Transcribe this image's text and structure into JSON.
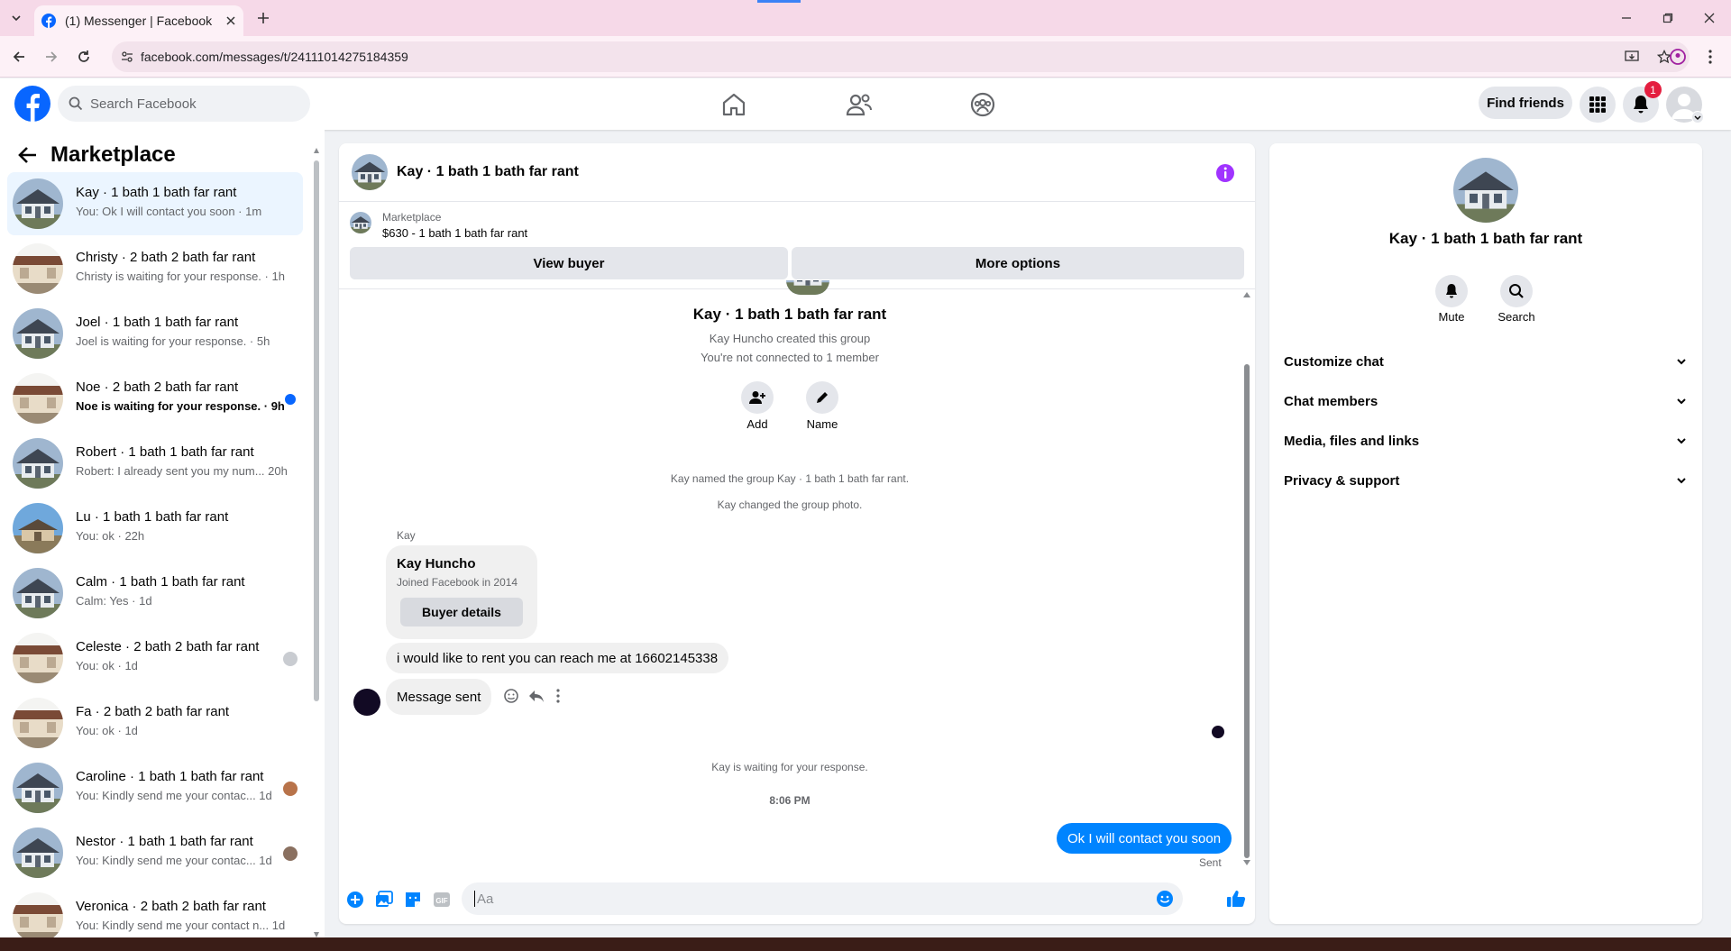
{
  "browser": {
    "tab_title": "(1) Messenger | Facebook",
    "url": "facebook.com/messages/t/24111014275184359"
  },
  "header": {
    "search_placeholder": "Search Facebook",
    "find_friends": "Find friends",
    "notification_count": "1"
  },
  "sidebar": {
    "title": "Marketplace",
    "conversations": [
      {
        "name": "Kay · 1 bath 1 bath far rant",
        "preview": "You: Ok I will contact you soon · 1m",
        "thumb": "house-gray",
        "active": true
      },
      {
        "name": "Christy · 2 bath 2 bath far rant",
        "preview": "Christy is waiting for your response. · 1h",
        "thumb": "house-brown"
      },
      {
        "name": "Joel · 1 bath 1 bath far rant",
        "preview": "Joel is waiting for your response. · 5h",
        "thumb": "house-gray"
      },
      {
        "name": "Noe · 2 bath 2 bath far rant",
        "preview": "Noe is waiting for your response. · 9h",
        "thumb": "house-brown",
        "unread": true
      },
      {
        "name": "Robert · 1 bath 1 bath far rant",
        "preview": "Robert: I already sent you my num...  20h",
        "thumb": "house-gray"
      },
      {
        "name": "Lu · 1 bath 1 bath far rant",
        "preview": "You: ok · 22h",
        "thumb": "house-sky"
      },
      {
        "name": "Calm · 1 bath 1 bath far rant",
        "preview": "Calm: Yes · 1d",
        "thumb": "house-gray"
      },
      {
        "name": "Celeste · 2 bath 2 bath far rant",
        "preview": "You: ok · 1d",
        "thumb": "house-brown",
        "tag": "avatar-gray"
      },
      {
        "name": "Fa · 2 bath 2 bath far rant",
        "preview": "You: ok · 1d",
        "thumb": "house-brown"
      },
      {
        "name": "Caroline · 1 bath 1 bath far rant",
        "preview": "You: Kindly send me your contac...  1d",
        "thumb": "house-gray",
        "tag": "avatar-orange"
      },
      {
        "name": "Nestor · 1 bath 1 bath far rant",
        "preview": "You: Kindly send me your contac...  1d",
        "thumb": "house-gray",
        "tag": "avatar-brown"
      },
      {
        "name": "Veronica · 2 bath 2 bath far rant",
        "preview": "You: Kindly send me your contact n...  1d",
        "thumb": "house-brown"
      }
    ]
  },
  "chat": {
    "title": "Kay · 1 bath 1 bath far rant",
    "marketplace_label": "Marketplace",
    "listing": "$630 - 1 bath 1 bath far rant",
    "view_buyer": "View buyer",
    "more_options": "More options",
    "intro_title": "Kay · 1 bath 1 bath far rant",
    "created_by": "Kay Huncho created this group",
    "not_connected": "You're not connected to 1 member",
    "add_label": "Add",
    "name_label": "Name",
    "event1": "Kay named the group Kay · 1 bath 1 bath far rant.",
    "event2": "Kay changed the group photo.",
    "sender": "Kay",
    "card_name": "Kay Huncho",
    "card_joined": "Joined Facebook in 2014",
    "buyer_details": "Buyer details",
    "msg1": "i would like to rent you can reach me at 16602145338",
    "msg2": "Message sent",
    "waiting": "Kay is waiting for your response.",
    "time": "8:06 PM",
    "my_msg": "Ok I will contact you soon",
    "sent_status": "Sent",
    "input_placeholder": "Aa"
  },
  "details": {
    "title": "Kay · 1 bath 1 bath far rant",
    "mute": "Mute",
    "search": "Search",
    "sections": [
      "Customize chat",
      "Chat members",
      "Media, files and links",
      "Privacy & support"
    ]
  },
  "colors": {
    "fb_blue": "#0866ff",
    "messenger_blue": "#0084ff",
    "notification_red": "#e41e3f",
    "info_purple": "#a033ff"
  }
}
